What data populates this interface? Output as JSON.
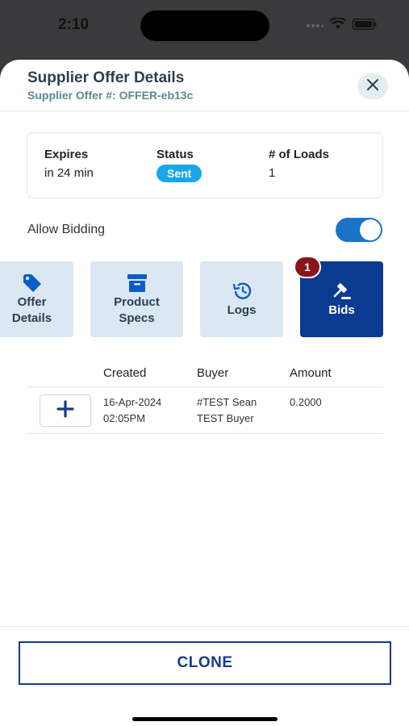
{
  "status_bar": {
    "time": "2:10"
  },
  "header": {
    "title": "Supplier Offer Details",
    "subtitle": "Supplier Offer #: OFFER-eb13c"
  },
  "info": {
    "expires_label": "Expires",
    "expires_value": "in 24 min",
    "status_label": "Status",
    "status_value": "Sent",
    "loads_label": "# of Loads",
    "loads_value": "1"
  },
  "bidding": {
    "label": "Allow Bidding",
    "enabled": true
  },
  "tabs": [
    {
      "label_line1": "Offer",
      "label_line2": "Details",
      "icon": "tag-icon"
    },
    {
      "label_line1": "Product",
      "label_line2": "Specs",
      "icon": "archive-icon"
    },
    {
      "label_line1": "Logs",
      "label_line2": "",
      "icon": "history-icon"
    },
    {
      "label_line1": "Bids",
      "label_line2": "",
      "icon": "gavel-icon",
      "badge": "1",
      "active": true
    }
  ],
  "bids_table": {
    "headers": [
      "Created",
      "Buyer",
      "Amount"
    ],
    "rows": [
      {
        "created_date": "16-Apr-2024",
        "created_time": "02:05PM",
        "buyer_line1": "#TEST Sean",
        "buyer_line2": "TEST Buyer",
        "amount": "0.2000"
      }
    ]
  },
  "footer": {
    "clone_label": "CLONE"
  },
  "colors": {
    "primary": "#0b3a91",
    "accent": "#1aa7e8",
    "badge": "#8b1419",
    "toggle": "#1a73c9"
  }
}
